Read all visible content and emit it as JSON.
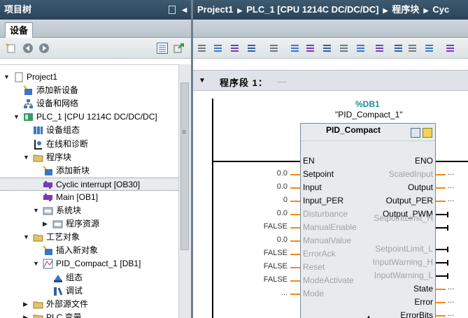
{
  "left_panel": {
    "title": "项目树",
    "tab": "设备",
    "tree": [
      {
        "label": "Project1",
        "icon": "project-icon",
        "expanded": true
      },
      {
        "label": "添加新设备",
        "icon": "add-device-icon"
      },
      {
        "label": "设备和网络",
        "icon": "network-icon"
      },
      {
        "label": "PLC_1 [CPU 1214C DC/DC/DC]",
        "icon": "plc-icon",
        "expanded": true
      },
      {
        "label": "设备组态",
        "icon": "device-config-icon"
      },
      {
        "label": "在线和诊断",
        "icon": "diagnostics-icon"
      },
      {
        "label": "程序块",
        "icon": "folder-icon",
        "expanded": true
      },
      {
        "label": "添加新块",
        "icon": "add-block-icon"
      },
      {
        "label": "Cyclic interrupt [OB30]",
        "icon": "ob-block-icon",
        "selected": true
      },
      {
        "label": "Main [OB1]",
        "icon": "ob-block-icon"
      },
      {
        "label": "系统块",
        "icon": "system-block-icon",
        "expanded": true
      },
      {
        "label": "程序资源",
        "icon": "system-block-icon",
        "expanded": false
      },
      {
        "label": "工艺对象",
        "icon": "folder-icon",
        "expanded": true
      },
      {
        "label": "插入新对象",
        "icon": "add-block-icon"
      },
      {
        "label": "PID_Compact_1 [DB1]",
        "icon": "pid-object-icon",
        "expanded": true
      },
      {
        "label": "组态",
        "icon": "config-icon"
      },
      {
        "label": "调试",
        "icon": "commissioning-icon"
      },
      {
        "label": "外部源文件",
        "icon": "folder-icon",
        "expanded": false
      },
      {
        "label": "PLC 变量",
        "icon": "folder-icon",
        "expanded": false
      }
    ]
  },
  "breadcrumb": {
    "items": [
      "Project1",
      "PLC_1 [CPU 1214C DC/DC/DC]",
      "程序块",
      "Cyc"
    ]
  },
  "network": {
    "title": "程序段 1：",
    "comment": "....."
  },
  "block": {
    "db_address": "%DB1",
    "instance": "\"PID_Compact_1\"",
    "name": "PID_Compact",
    "inputs": [
      {
        "pin": "EN",
        "value": "",
        "dim": false
      },
      {
        "pin": "Setpoint",
        "value": "0.0",
        "dim": false
      },
      {
        "pin": "Input",
        "value": "0.0",
        "dim": false
      },
      {
        "pin": "Input_PER",
        "value": "0",
        "dim": false
      },
      {
        "pin": "Disturbance",
        "value": "0.0",
        "dim": true
      },
      {
        "pin": "ManualEnable",
        "value": "FALSE",
        "dim": true
      },
      {
        "pin": "ManualValue",
        "value": "0.0",
        "dim": true
      },
      {
        "pin": "ErrorAck",
        "value": "FALSE",
        "dim": true
      },
      {
        "pin": "Reset",
        "value": "FALSE",
        "dim": true
      },
      {
        "pin": "ModeActivate",
        "value": "FALSE",
        "dim": true
      },
      {
        "pin": "Mode",
        "value": "...",
        "dim": true
      }
    ],
    "outputs": [
      {
        "pin": "ENO",
        "value": "",
        "dim": false
      },
      {
        "pin": "ScaledInput",
        "value": "...",
        "dim": true
      },
      {
        "pin": "Output",
        "value": "...",
        "dim": false
      },
      {
        "pin": "Output_PER",
        "value": "...",
        "dim": false
      },
      {
        "pin": "Output_PWM",
        "value": "",
        "dim": false
      },
      {
        "pin": "SetpointLimit_H",
        "value": "",
        "dim": true
      },
      {
        "pin": "SetpointLimit_L",
        "value": "",
        "dim": true
      },
      {
        "pin": "InputWarning_H",
        "value": "",
        "dim": true
      },
      {
        "pin": "InputWarning_L",
        "value": "",
        "dim": true
      },
      {
        "pin": "State",
        "value": "...",
        "dim": false
      },
      {
        "pin": "Error",
        "value": "...",
        "dim": false
      },
      {
        "pin": "ErrorBits",
        "value": "...",
        "dim": false
      }
    ]
  },
  "colors": {
    "title_bar": "#2f4a5f",
    "db_address": "#1e8f8f",
    "wire": "#f08c14",
    "selected_row": "#e8ecef"
  }
}
